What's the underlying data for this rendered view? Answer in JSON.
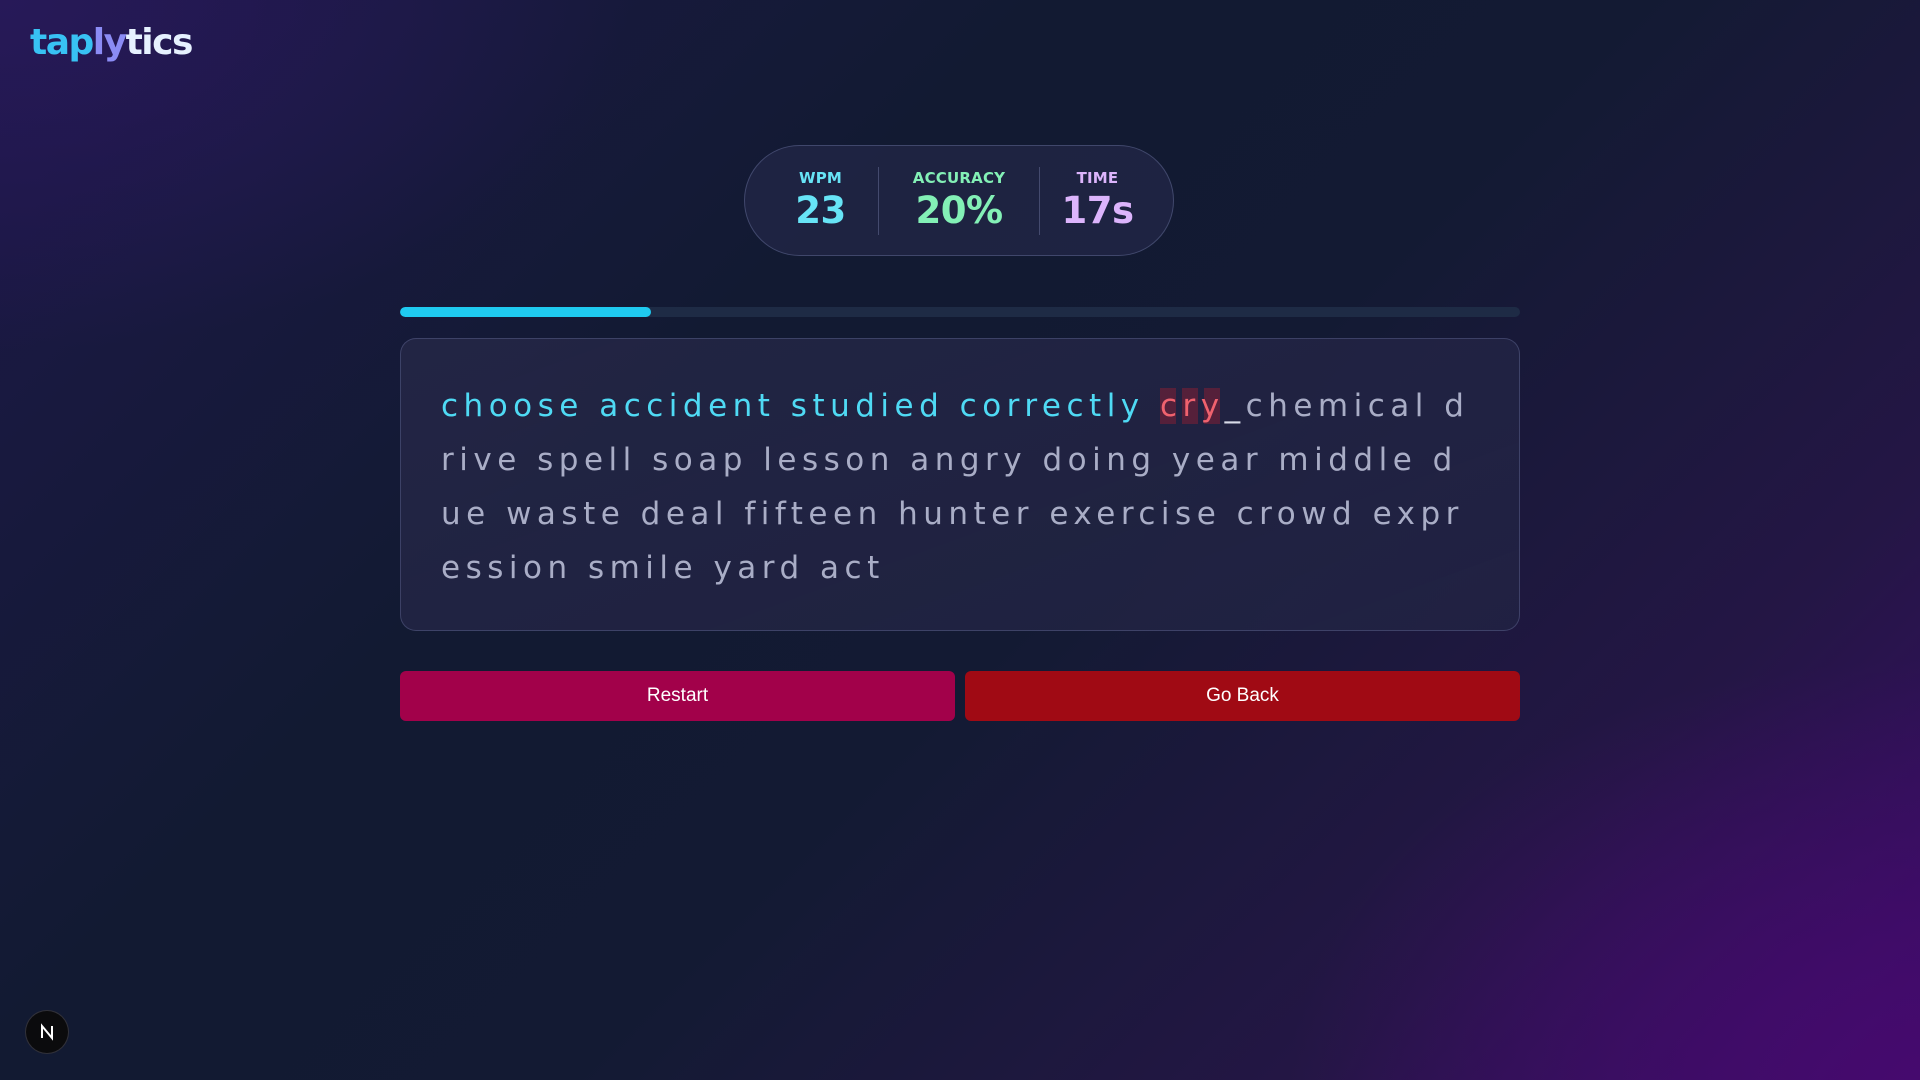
{
  "brand": {
    "part1": "tap",
    "part2": "ly",
    "part3": "tics"
  },
  "stats": {
    "wpm": {
      "label": "WPM",
      "value": "23"
    },
    "accuracy": {
      "label": "ACCURACY",
      "value": "20%"
    },
    "time": {
      "label": "TIME",
      "value": "17s"
    }
  },
  "progress": {
    "fraction": 0.224
  },
  "text": {
    "typed": "choose accident studied correctly ",
    "error": "cry",
    "caret": "_",
    "remaining": "chemical drive spell soap lesson angry doing year middle due waste deal fifteen hunter exercise crowd expression smile yard act"
  },
  "buttons": {
    "restart": "Restart",
    "go_back": "Go Back"
  },
  "badge": {
    "icon": "next-n-icon"
  },
  "colors": {
    "typed": "#4fdaf4",
    "error": "#f0626e",
    "restart_bg": "#a2014a",
    "go_back_bg": "#a00a14",
    "progress": "#1fcaf0"
  }
}
